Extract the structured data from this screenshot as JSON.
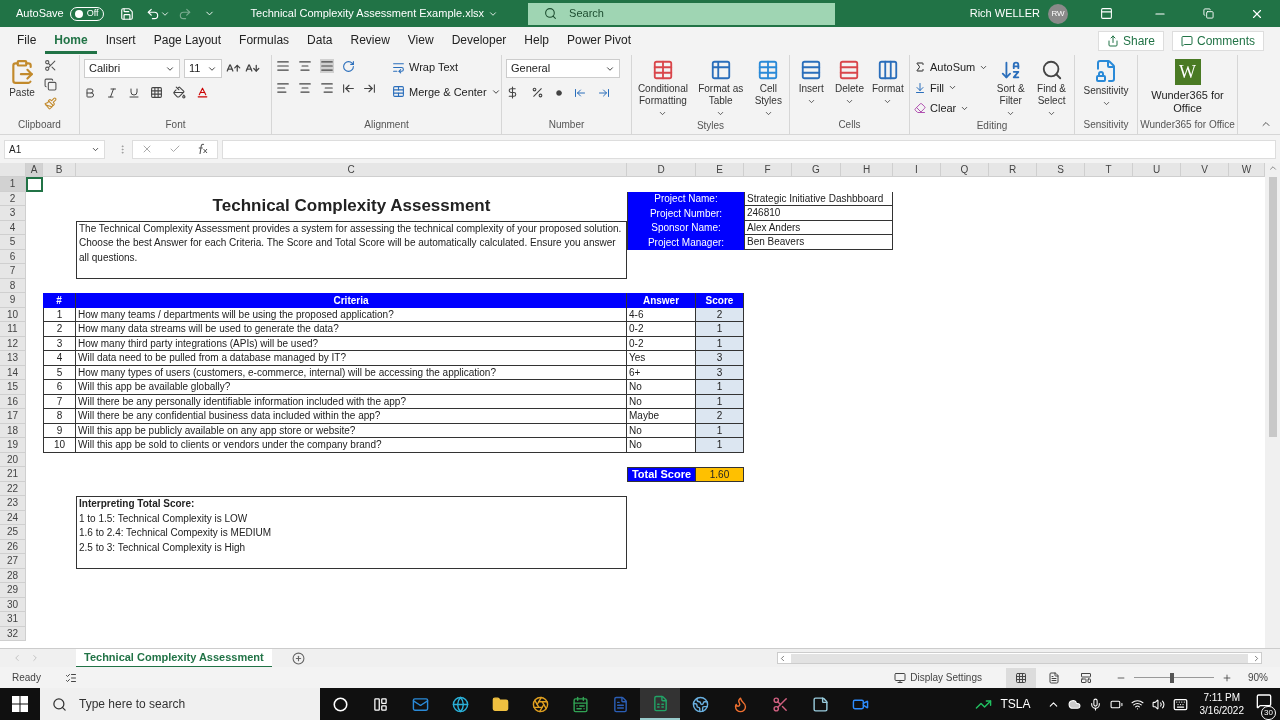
{
  "title_bar": {
    "autosave_label": "AutoSave",
    "autosave": {
      "on": false,
      "label": "Off"
    },
    "file_name": "Technical Complexity Assessment Example.xlsx",
    "search_placeholder": "Search",
    "user_name": "Rich WELLER",
    "user_initials": "RW"
  },
  "menu_tabs": [
    {
      "label": "File",
      "selected": false
    },
    {
      "label": "Home",
      "selected": true
    },
    {
      "label": "Insert",
      "selected": false
    },
    {
      "label": "Page Layout",
      "selected": false
    },
    {
      "label": "Formulas",
      "selected": false
    },
    {
      "label": "Data",
      "selected": false
    },
    {
      "label": "Review",
      "selected": false
    },
    {
      "label": "View",
      "selected": false
    },
    {
      "label": "Developer",
      "selected": false
    },
    {
      "label": "Help",
      "selected": false
    },
    {
      "label": "Power Pivot",
      "selected": false
    }
  ],
  "share": "Share",
  "comments": "Comments",
  "ribbon": {
    "clipboard": {
      "paste": "Paste",
      "label": "Clipboard"
    },
    "font": {
      "family": "Calibri",
      "size": "11",
      "label": "Font"
    },
    "alignment": {
      "wrap": "Wrap Text",
      "merge": "Merge & Center",
      "label": "Alignment"
    },
    "number": {
      "format": "General",
      "label": "Number"
    },
    "styles": {
      "buttons": [
        "Conditional Formatting",
        "Format as Table",
        "Cell Styles"
      ],
      "label": "Styles"
    },
    "cells": {
      "buttons": [
        "Insert",
        "Delete",
        "Format"
      ],
      "label": "Cells"
    },
    "editing": {
      "small": [
        "AutoSum",
        "Fill",
        "Clear"
      ],
      "large": [
        "Sort & Filter",
        "Find & Select"
      ],
      "label": "Editing"
    },
    "sensitivity": {
      "button": "Sensitivity",
      "label": "Sensitivity"
    },
    "addin": {
      "logo": "W",
      "button": "Wunder365 for Office",
      "label": "Wunder365 for Office"
    }
  },
  "name_box": "A1",
  "columns": [
    "A",
    "B",
    "C",
    "D",
    "E",
    "F",
    "G",
    "H",
    "I",
    "Q",
    "R",
    "S",
    "T",
    "U",
    "V",
    "W"
  ],
  "rows": [
    "1",
    "2",
    "3",
    "4",
    "5",
    "6",
    "7",
    "8",
    "9",
    "10",
    "11",
    "12",
    "13",
    "14",
    "15",
    "16",
    "17",
    "18",
    "19",
    "20",
    "21",
    "22",
    "23",
    "24",
    "25",
    "26",
    "27",
    "28",
    "29",
    "30",
    "31",
    "32"
  ],
  "sheet": {
    "heading": "Technical Complexity Assessment",
    "project_info": [
      {
        "label": "Project Name:",
        "value": "Strategic Initiative Dashbboard"
      },
      {
        "label": "Project Number:",
        "value": "246810"
      },
      {
        "label": "Sponsor Name:",
        "value": "Alex Anders"
      },
      {
        "label": "Project Manager:",
        "value": "Ben Beavers"
      }
    ],
    "description": "The Technical Complexity Assessment provides a system for assessing the technical complexity of your proposed solution.  Choose the best Answer for each Criteria. The Score and Total Score will be automatically calculated.  Ensure you answer all questions.",
    "table": {
      "columns": [
        "#",
        "Criteria",
        "Answer",
        "Score"
      ],
      "rows": [
        [
          "1",
          "How many teams / departments will be using the proposed application?",
          "4-6",
          "2"
        ],
        [
          "2",
          "How many data streams will be used to generate the data?",
          "0-2",
          "1"
        ],
        [
          "3",
          "How many third party integrations (APIs) will be used?",
          "0-2",
          "1"
        ],
        [
          "4",
          "Will data need to be pulled from a database managed by IT?",
          "Yes",
          "3"
        ],
        [
          "5",
          "How many types of users (customers, e-commerce, internal) will be accessing the application?",
          "6+",
          "3"
        ],
        [
          "6",
          "Will this app be available globally?",
          "No",
          "1"
        ],
        [
          "7",
          "Will there be any personally identifiable information included with the app?",
          "No",
          "1"
        ],
        [
          "8",
          "Will there be any confidential business data included within the app?",
          "Maybe",
          "2"
        ],
        [
          "9",
          "Will this app be publicly available on any app store or website?",
          "No",
          "1"
        ],
        [
          "10",
          "Will this app be sold to clients or vendors under the company brand?",
          "No",
          "1"
        ]
      ]
    },
    "total": {
      "label": "Total Score",
      "value": "1.60"
    },
    "interpreting": {
      "title": "Interpreting Total Score:",
      "lines": [
        "1 to 1.5: Technical Complexity is LOW",
        "1.6 to 2.4: Technical Compexity is MEDIUM",
        "2.5 to 3: Technical Complexity is High"
      ]
    }
  },
  "sheet_tabs": [
    {
      "label": "Technical Complexity Assessment",
      "selected": true
    }
  ],
  "status_bar": {
    "status": "Ready",
    "display_settings": "Display Settings",
    "zoom": {
      "level": 0.47,
      "label": "90%"
    }
  },
  "taskbar": {
    "search_placeholder": "Type here to search",
    "ticker": "TSLA",
    "time": "7:11 PM",
    "date": "3/16/2022",
    "notifications": "30"
  }
}
